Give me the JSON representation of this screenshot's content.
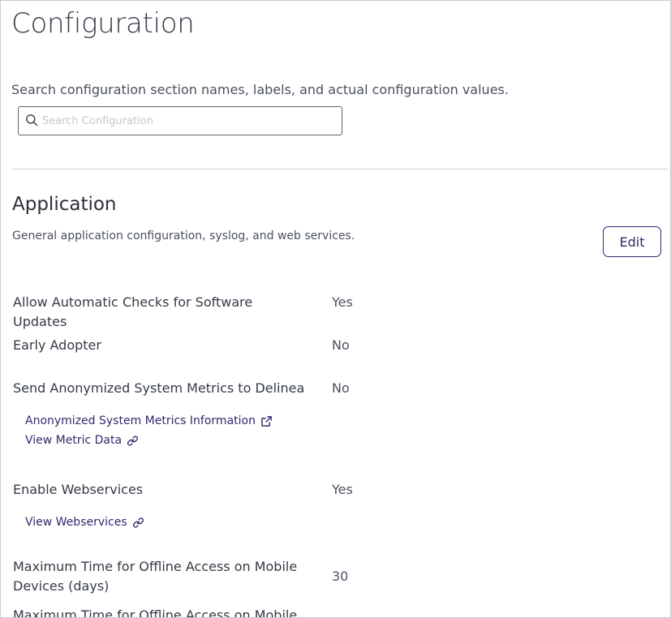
{
  "page": {
    "title": "Configuration"
  },
  "search": {
    "help_text": "Search configuration section names, labels, and actual configuration values.",
    "placeholder": "Search Configuration",
    "value": ""
  },
  "section": {
    "title": "Application",
    "description": "General application configuration, syslog, and web services.",
    "edit_label": "Edit",
    "settings": [
      {
        "label": "Allow Automatic Checks for Software Updates",
        "value": "Yes"
      },
      {
        "label": "Early Adopter",
        "value": "No"
      },
      {
        "label": "Send Anonymized System Metrics to Delinea",
        "value": "No"
      },
      {
        "label": "Enable Webservices",
        "value": "Yes"
      },
      {
        "label": "Maximum Time for Offline Access on Mobile Devices (days)",
        "value": "30"
      },
      {
        "label": "Maximum Time for Offline Access on Mobile",
        "value": ""
      }
    ],
    "links": {
      "metrics_info": "Anonymized System Metrics Information",
      "metric_data": "View Metric Data",
      "webservices": "View Webservices"
    }
  },
  "icons": {
    "search": "search-icon",
    "external_link": "external-link-icon",
    "link": "link-icon"
  },
  "colors": {
    "link": "#2e2a6b",
    "text": "#343a45",
    "border": "#c9c9d0"
  }
}
